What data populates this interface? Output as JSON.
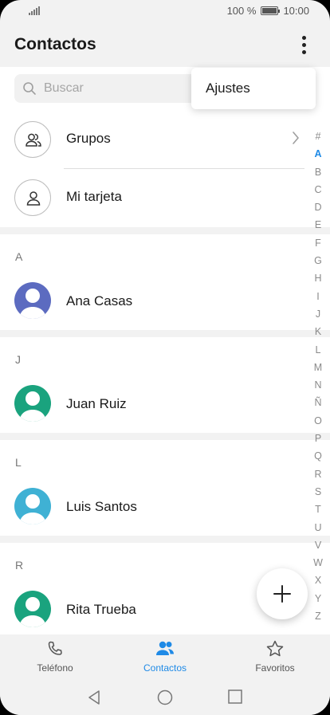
{
  "status_bar": {
    "battery_text": "100 %",
    "time": "10:00"
  },
  "app_bar": {
    "title": "Contactos",
    "menu_icon": "more-vert-icon"
  },
  "search": {
    "placeholder": "Buscar",
    "icon": "search-icon"
  },
  "menu_popup": {
    "items": [
      {
        "label": "Ajustes"
      }
    ]
  },
  "top_items": [
    {
      "label": "Grupos",
      "icon": "group-icon",
      "has_chevron": true
    },
    {
      "label": "Mi tarjeta",
      "icon": "person-icon"
    }
  ],
  "sections": [
    {
      "letter": "A",
      "contacts": [
        {
          "name": "Ana Casas",
          "avatar_color": "#5c6bc0"
        }
      ]
    },
    {
      "letter": "J",
      "contacts": [
        {
          "name": "Juan Ruiz",
          "avatar_color": "#1aa37e"
        }
      ]
    },
    {
      "letter": "L",
      "contacts": [
        {
          "name": "Luis Santos",
          "avatar_color": "#3fb1d4"
        }
      ]
    },
    {
      "letter": "R",
      "contacts": [
        {
          "name": "Rita Trueba",
          "avatar_color": "#1aa37e"
        }
      ]
    }
  ],
  "index_letters": [
    "#",
    "A",
    "B",
    "C",
    "D",
    "E",
    "F",
    "G",
    "H",
    "I",
    "J",
    "K",
    "L",
    "M",
    "N",
    "Ñ",
    "O",
    "P",
    "Q",
    "R",
    "S",
    "T",
    "U",
    "V",
    "W",
    "X",
    "Y",
    "Z"
  ],
  "index_active": "A",
  "fab": {
    "icon": "plus-icon"
  },
  "bottom_nav": [
    {
      "label": "Teléfono",
      "icon": "phone-icon",
      "active": false
    },
    {
      "label": "Contactos",
      "icon": "contacts-icon",
      "active": true
    },
    {
      "label": "Favoritos",
      "icon": "star-icon",
      "active": false
    }
  ],
  "system_nav": [
    "back-icon",
    "home-icon",
    "recents-icon"
  ],
  "colors": {
    "accent": "#1f8ae6",
    "background": "#f2f2f2"
  }
}
